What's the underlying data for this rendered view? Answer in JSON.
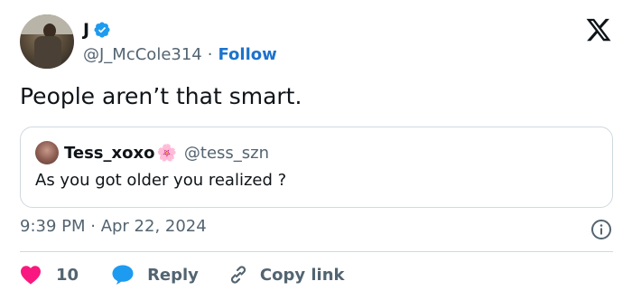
{
  "author": {
    "name": "J",
    "handle": "@J_McCole314",
    "separator": "·",
    "follow_label": "Follow",
    "verified": true
  },
  "tweet": {
    "text": "People aren’t that smart.",
    "timestamp": "9:39 PM · Apr 22, 2024"
  },
  "quoted_tweet": {
    "name": "Tess_xoxo",
    "emoji": "🌸",
    "handle": "@tess_szn",
    "text": "As you got older you realized ?"
  },
  "actions": {
    "like_count": "10",
    "reply_label": "Reply",
    "copy_link_label": "Copy link"
  },
  "colors": {
    "like": "#f91880",
    "reply": "#1d9bf0",
    "follow": "#1d73cc",
    "verified": "#1d9bf0",
    "secondary_text": "#536471"
  },
  "icons": [
    "verified-icon",
    "x-logo-icon",
    "info-icon",
    "heart-icon",
    "reply-bubble-icon",
    "link-icon"
  ]
}
